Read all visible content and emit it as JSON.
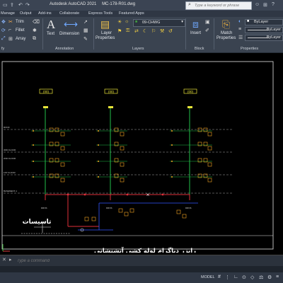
{
  "app": {
    "title": "Autodesk AutoCAD 2021",
    "document": "MC-178-R01.dwg"
  },
  "search": {
    "placeholder": "Type a keyword or phrase"
  },
  "menu": {
    "items": [
      "Manage",
      "Output",
      "Add-ins",
      "Collaborate",
      "Express Tools",
      "Featured Apps"
    ]
  },
  "ribbon": {
    "modify": {
      "trim": "Trim",
      "fillet": "Fillet",
      "array": "Array",
      "panel": "fy"
    },
    "annotation": {
      "text": "Text",
      "dimension": "Dimension",
      "panel": "Annotation"
    },
    "layers": {
      "layer_properties_line1": "Layer",
      "layer_properties_line2": "Properties",
      "current_layer": "09-CHWG",
      "panel": "Layers"
    },
    "block": {
      "insert": "Insert",
      "panel": "Block"
    },
    "properties": {
      "match_line1": "Match",
      "match_line2": "Properties",
      "bylayer_color": "ByLayer",
      "bylayer_linetype": "ByLayer",
      "bylayer_lineweight": "ByLayer",
      "panel": "Properties"
    }
  },
  "drawing": {
    "riser_tags": [
      "(00)",
      "(00)",
      "(00)"
    ],
    "left_labels": [
      "ROOF",
      "3RD FLOOR",
      "2ND FLOOR",
      "1ST FLOOR",
      "BASEMENT-1"
    ],
    "diagram_title": "رایزر دیاگرام  لوله کشی آتشنشانی",
    "installations_label": "تاسیسات",
    "drain_labels": [
      "DRNS",
      "DRNS",
      "DRNS"
    ]
  },
  "command": {
    "placeholder": "Type a command"
  },
  "status": {
    "model": "MODEL"
  },
  "colors": {
    "titlebar": "#3b4453",
    "ribbon": "#3a4350",
    "canvas": "#000000",
    "pipe_green": "#22c04a",
    "pipe_red": "#e0303a",
    "pipe_blue": "#3355ff",
    "tag_yellow": "#e8e43a",
    "sprinkler_orange": "#f5a623"
  }
}
